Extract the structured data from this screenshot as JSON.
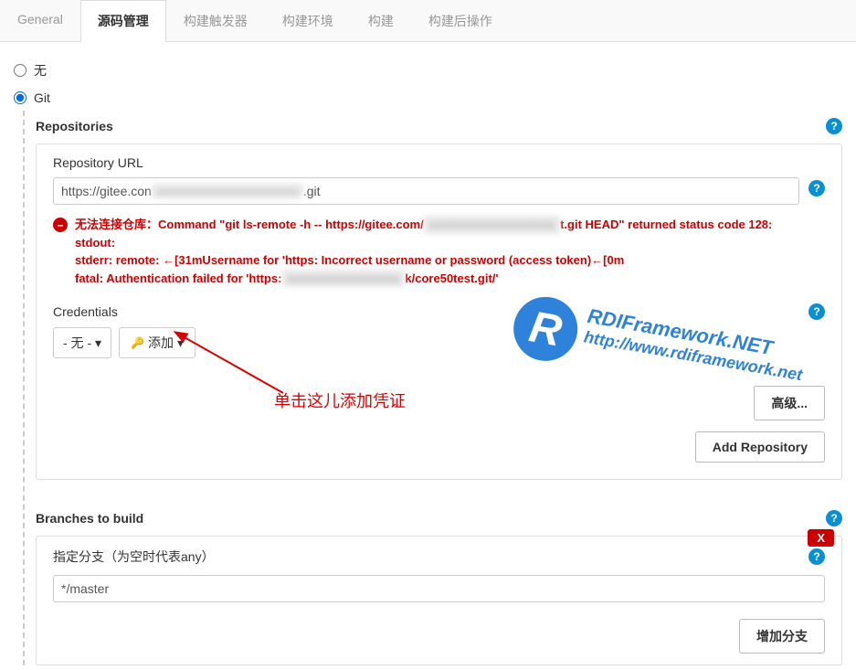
{
  "tabs": [
    {
      "label": "General"
    },
    {
      "label": "源码管理"
    },
    {
      "label": "构建触发器"
    },
    {
      "label": "构建环境"
    },
    {
      "label": "构建"
    },
    {
      "label": "构建后操作"
    }
  ],
  "activeTab": 1,
  "scm": {
    "none_label": "无",
    "git_label": "Git",
    "selected": "git"
  },
  "repositories_header": "Repositories",
  "repo": {
    "url_label": "Repository URL",
    "url_value_prefix": "https://gitee.con",
    "url_value_suffix": ".git",
    "error": {
      "line1_a": "无法连接仓库：Command \"git ls-remote -h -- https://gitee.com/",
      "line1_b": "t.git HEAD\" returned status code 128:",
      "line2": "stdout:",
      "line3": "stderr: remote: ←[31mUsername for 'https: Incorrect username or password (access token)←[0m",
      "line4_a": "fatal: Authentication failed for 'https:",
      "line4_b": "k/core50test.git/'"
    },
    "credentials_label": "Credentials",
    "cred_select": "- 无 - ",
    "add_button": "添加",
    "advanced_button": "高级...",
    "add_repo_button": "Add Repository"
  },
  "branches_header": "Branches to build",
  "branch": {
    "specifier_label": "指定分支（为空时代表any）",
    "value": "*/master",
    "add_branch_button": "增加分支",
    "close_badge": "X"
  },
  "annotation_text": "单击这儿添加凭证",
  "watermark": {
    "logo": "R",
    "text": "RDIFramework.NET",
    "url": "http://www.rdiframework.net"
  }
}
